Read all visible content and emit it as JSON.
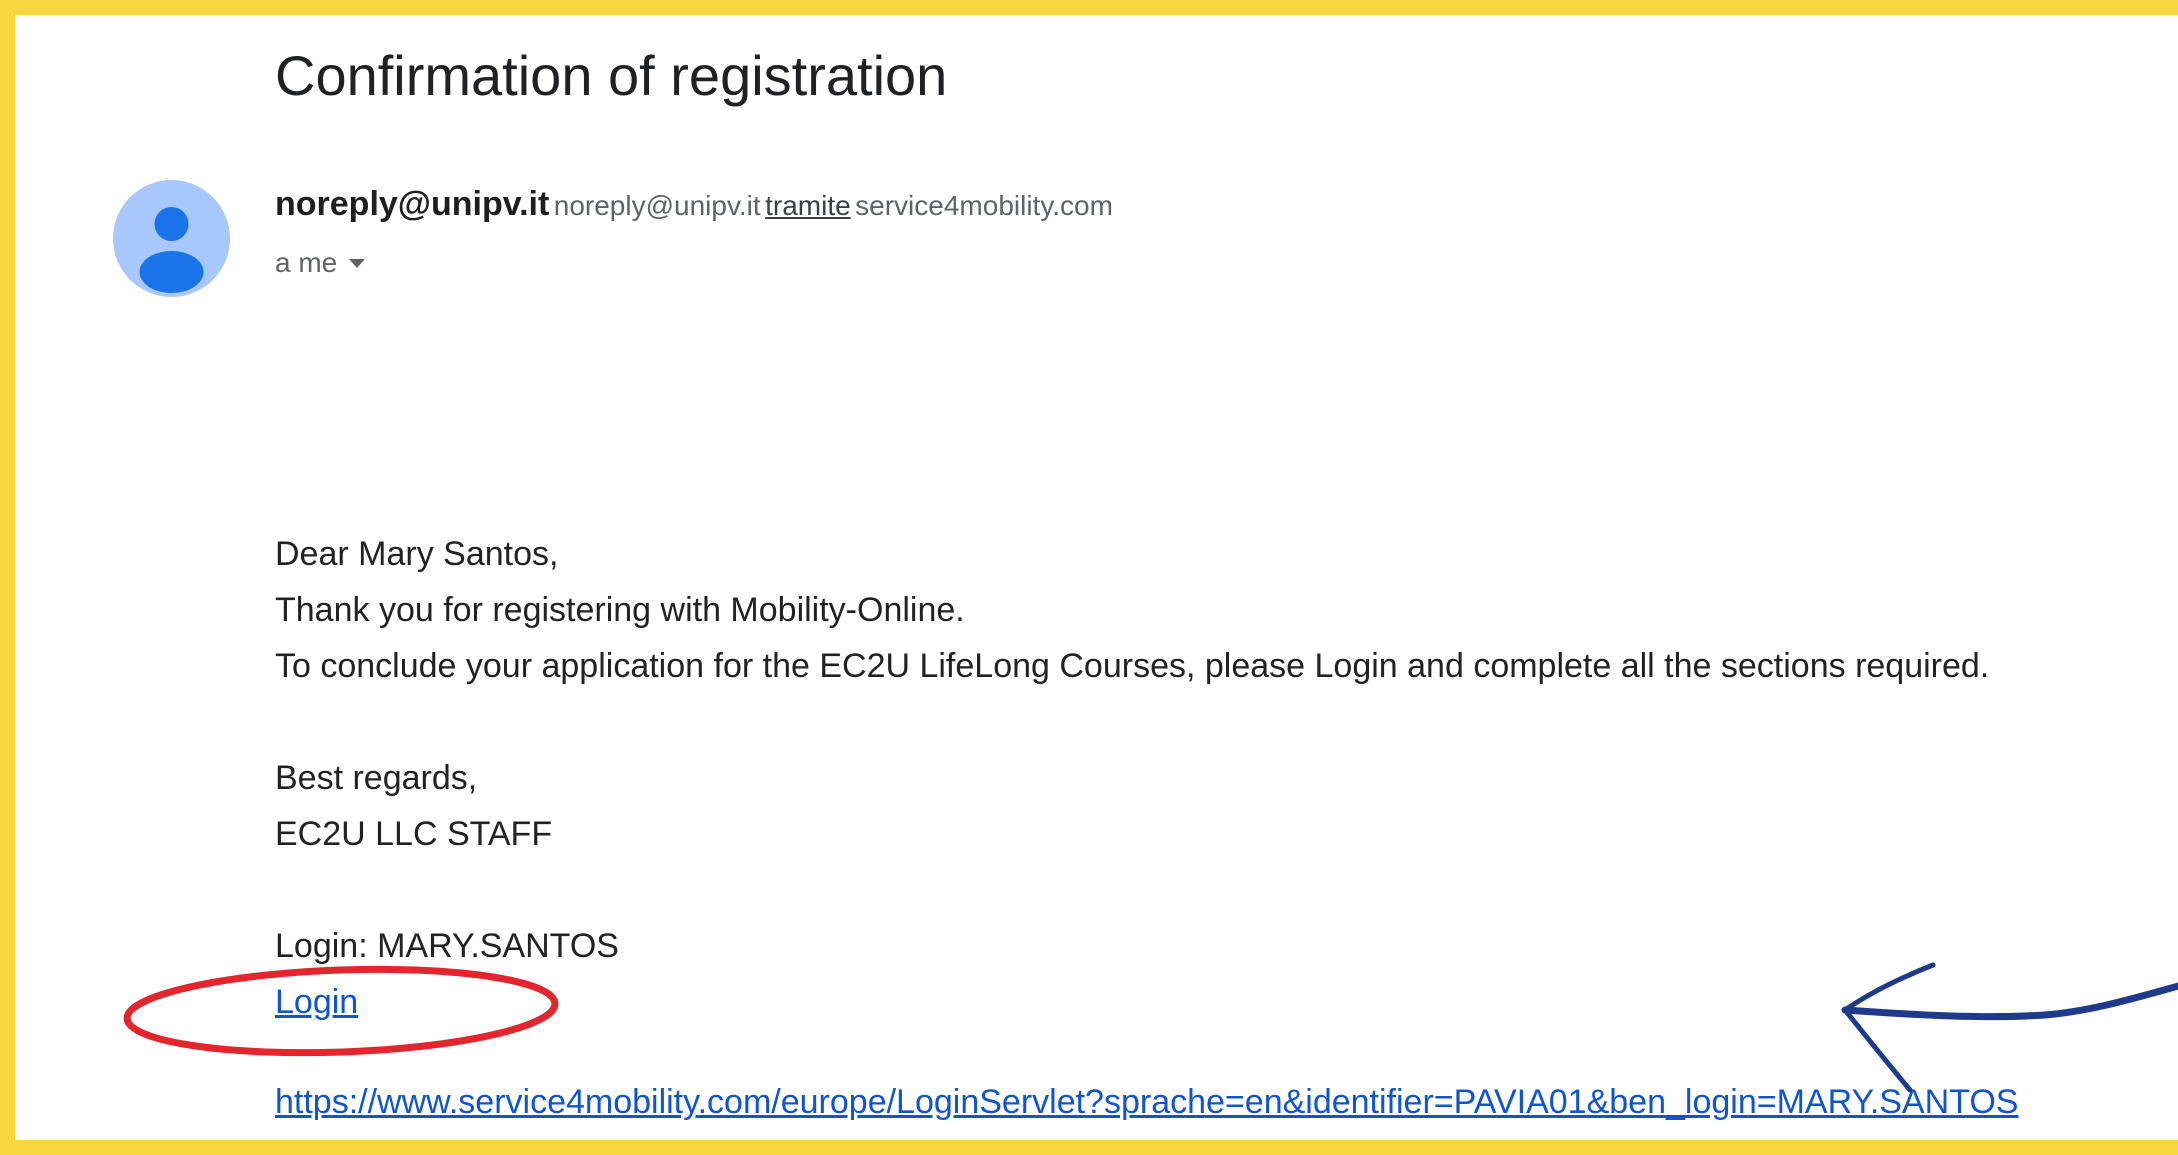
{
  "email": {
    "subject": "Confirmation of registration",
    "sender": {
      "name": "noreply@unipv.it",
      "email": "noreply@unipv.it",
      "via_word": "tramite",
      "via_domain": "service4mobility.com"
    },
    "recipient": "a me",
    "avatar_icon": "person-avatar-icon",
    "body": {
      "greeting": "Dear Mary Santos,",
      "line1": "Thank you for registering with Mobility-Online.",
      "line2": "To conclude your application for the EC2U LifeLong Courses, please Login and complete all the sections required.",
      "regards": "Best regards,",
      "signature": "EC2U LLC STAFF",
      "login_label": "Login: MARY.SANTOS",
      "login_link": "Login",
      "url_link": "https://www.service4mobility.com/europe/LoginServlet?sprache=en&identifier=PAVIA01&ben_login=MARY.SANTOS"
    }
  },
  "colors": {
    "frame": "#f7d73c",
    "link": "#1155cc",
    "highlight_ellipse": "#e3262e",
    "arrow": "#1f3a8a",
    "avatar_bg": "#a8c7fa",
    "avatar_fg": "#1a73e8"
  }
}
